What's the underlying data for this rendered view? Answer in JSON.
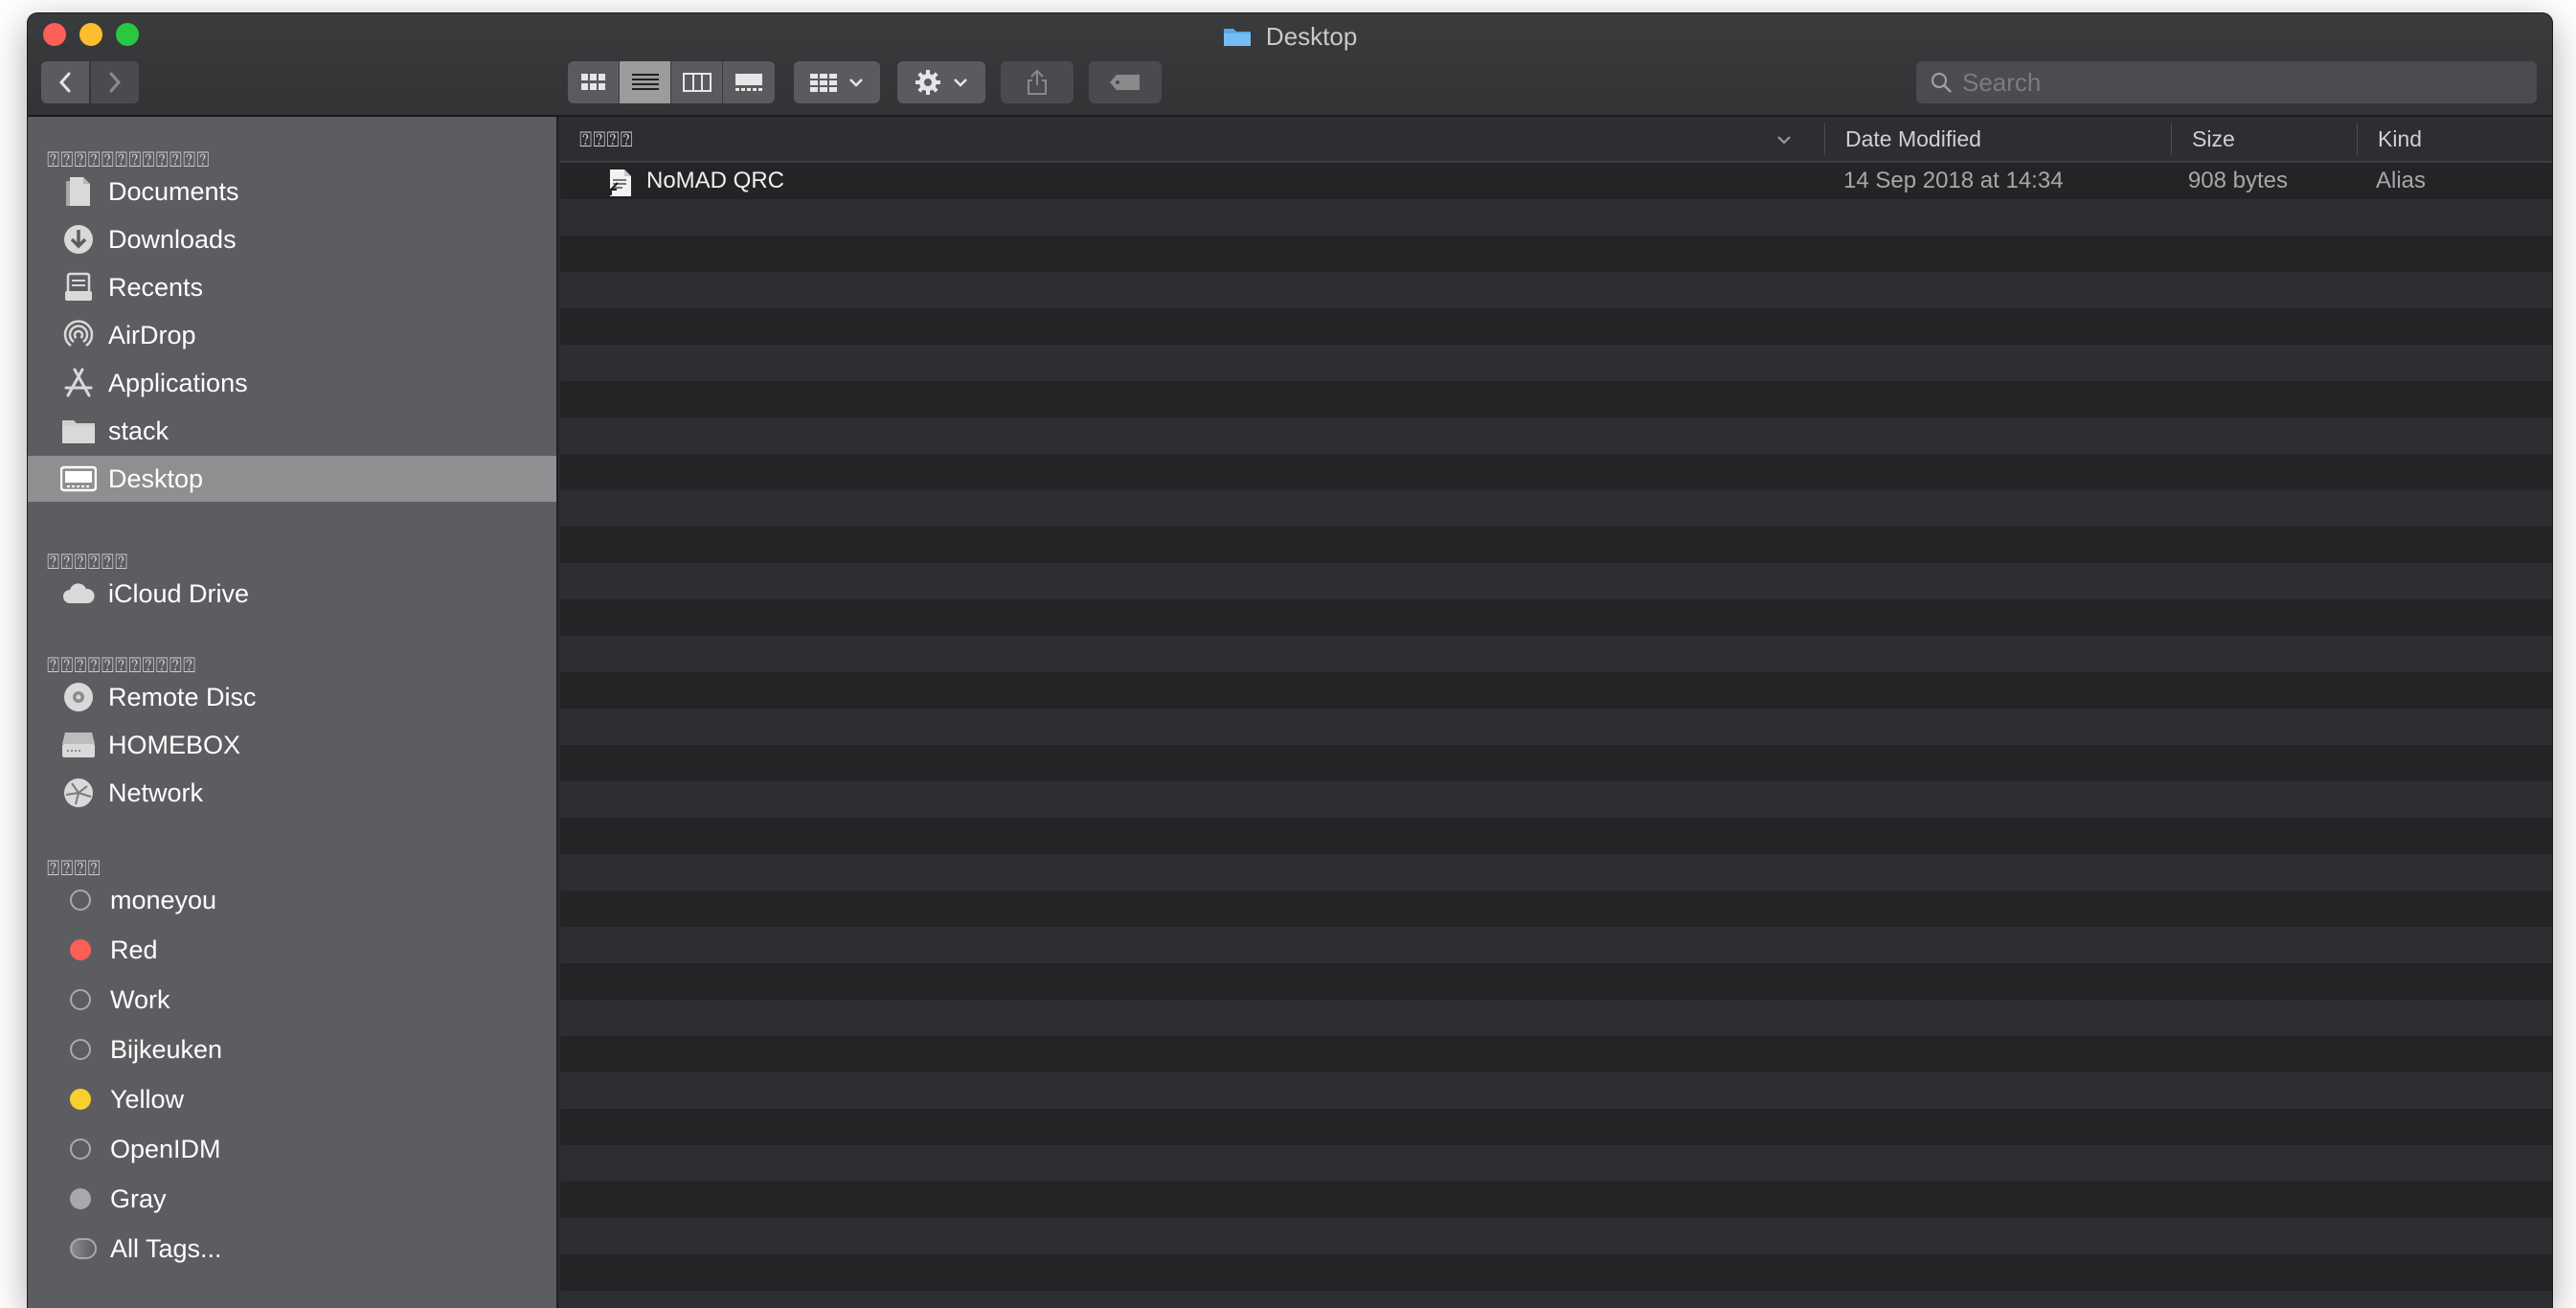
{
  "window": {
    "title": "Desktop"
  },
  "toolbar": {
    "search_placeholder": "Search"
  },
  "sidebar": {
    "favorites_header": "⍰⍰⍰⍰⍰⍰⍰⍰⍰⍰⍰⍰",
    "favorites": [
      {
        "label": "Documents",
        "icon": "documents-icon"
      },
      {
        "label": "Downloads",
        "icon": "downloads-icon"
      },
      {
        "label": "Recents",
        "icon": "recents-icon"
      },
      {
        "label": "AirDrop",
        "icon": "airdrop-icon"
      },
      {
        "label": "Applications",
        "icon": "applications-icon"
      },
      {
        "label": "stack",
        "icon": "folder-icon"
      },
      {
        "label": "Desktop",
        "icon": "desktop-icon",
        "selected": true
      }
    ],
    "icloud_header": "⍰⍰⍰⍰⍰⍰",
    "icloud": [
      {
        "label": "iCloud Drive",
        "icon": "cloud-icon"
      }
    ],
    "locations_header": "⍰⍰⍰⍰⍰⍰⍰⍰⍰⍰⍰",
    "locations": [
      {
        "label": "Remote Disc",
        "icon": "disc-icon"
      },
      {
        "label": "HOMEBOX",
        "icon": "server-icon"
      },
      {
        "label": "Network",
        "icon": "network-icon"
      }
    ],
    "tags_header": "⍰⍰⍰⍰",
    "tags": [
      {
        "label": "moneyou",
        "color": "transparent"
      },
      {
        "label": "Red",
        "color": "#fd5f57"
      },
      {
        "label": "Work",
        "color": "transparent"
      },
      {
        "label": "Bijkeuken",
        "color": "transparent"
      },
      {
        "label": "Yellow",
        "color": "#f7d02f"
      },
      {
        "label": "OpenIDM",
        "color": "transparent"
      },
      {
        "label": "Gray",
        "color": "#a9a9ab"
      },
      {
        "label": "All Tags...",
        "color": "all"
      }
    ]
  },
  "columns": {
    "name": "⍰⍰⍰⍰",
    "date": "Date Modified",
    "size": "Size",
    "kind": "Kind"
  },
  "files": [
    {
      "name": "NoMAD QRC",
      "date": "14 Sep 2018 at 14:34",
      "size": "908 bytes",
      "kind": "Alias"
    }
  ],
  "colors": {
    "sidebar_bg": "#5c5d60",
    "selected_bg": "#8e8f91",
    "content_bg": "#232426"
  }
}
